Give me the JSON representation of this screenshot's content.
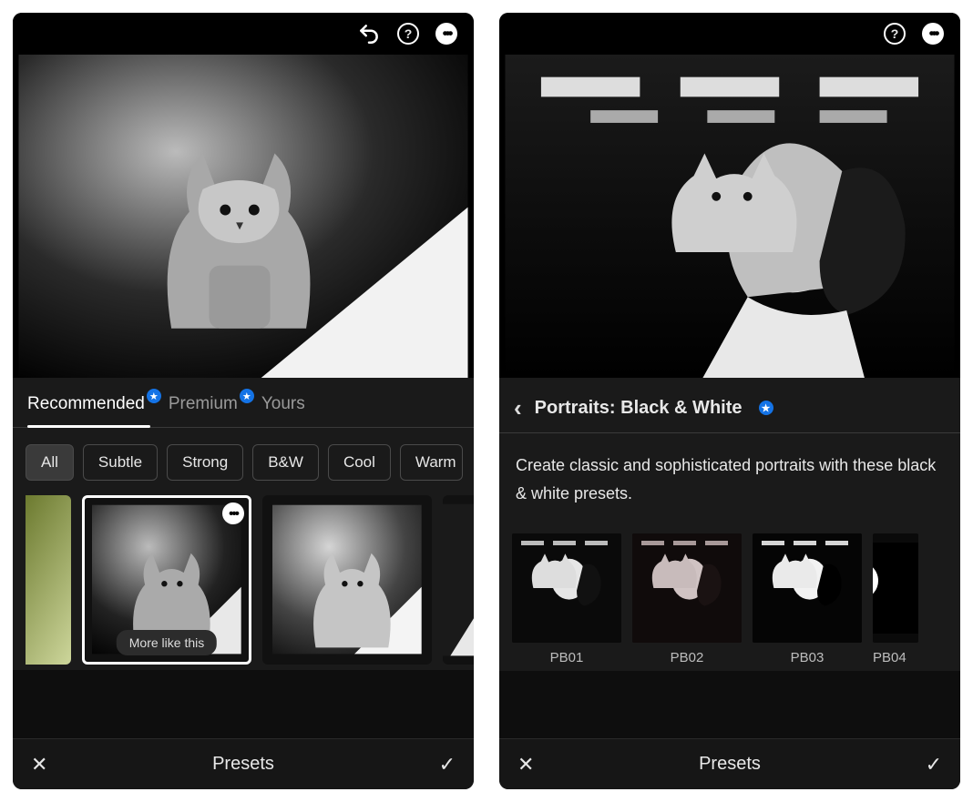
{
  "left": {
    "tabs": [
      {
        "label": "Recommended",
        "active": true,
        "star": true
      },
      {
        "label": "Premium",
        "active": false,
        "star": true
      },
      {
        "label": "Yours",
        "active": false,
        "star": false
      }
    ],
    "chips": [
      {
        "label": "All",
        "active": true
      },
      {
        "label": "Subtle",
        "active": false
      },
      {
        "label": "Strong",
        "active": false
      },
      {
        "label": "B&W",
        "active": false
      },
      {
        "label": "Cool",
        "active": false
      },
      {
        "label": "Warm",
        "active": false
      }
    ],
    "more_like_this": "More like this",
    "bottom": {
      "title": "Presets"
    }
  },
  "right": {
    "breadcrumb": "Portraits: Black & White",
    "breadcrumb_star": true,
    "description": "Create classic and sophisticated portraits with these black & white presets.",
    "presets": [
      {
        "label": "PB01"
      },
      {
        "label": "PB02"
      },
      {
        "label": "PB03"
      },
      {
        "label": "PB04"
      }
    ],
    "bottom": {
      "title": "Presets"
    }
  },
  "icons": {
    "undo": "↶",
    "help": "?",
    "more": "•••",
    "close": "✕",
    "check": "✓",
    "back": "‹",
    "star": "★"
  }
}
